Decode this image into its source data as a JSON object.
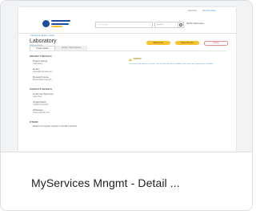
{
  "caption": "MyServices Mngmt - Detail ...",
  "preview": {
    "topbar": {
      "link1": "Need help",
      "link2": "Site Information"
    },
    "header": {
      "search_placeholder": "Find a page",
      "select_value": "Services",
      "account": "MyDSU Maintenance"
    },
    "breadcrumb": "< MyServices Mngmt - Detail",
    "title": "Laboratory",
    "subtitle": "MSM-0000-0000",
    "buttons": [
      "Edit Service",
      "Cancel Service",
      "Delete"
    ],
    "tabs": [
      "Project details",
      "Activity / SGS Inquiries"
    ],
    "project_details_heading": "PROJECT DETAILS",
    "fields": [
      {
        "label": "Project Name",
        "value": "Laboratory"
      },
      {
        "label": "Email",
        "value": "name@example.com"
      },
      {
        "label": "Research area",
        "value": "Biomedical research"
      }
    ],
    "contact_heading": "CONTACT DETAILS",
    "contacts": [
      {
        "label": "Customer Approver",
        "value": "Jane Doe"
      },
      {
        "label": "Organization",
        "value": "Cardiff University"
      },
      {
        "label": "Webpage",
        "value": "www.example.com"
      }
    ],
    "more_heading": "OTHER",
    "more_text": "Reason for request: access to the HPC services",
    "notice_heading": "NOTICE",
    "notice_text": "You have a new request to review. Check the Activity tab for updates and contact the support team if needed."
  },
  "colors": {
    "logo_blue": "#1f4e9e",
    "accent_yellow": "#f7c42f",
    "link_blue": "#4a90c8",
    "danger": "#c94a4a"
  }
}
